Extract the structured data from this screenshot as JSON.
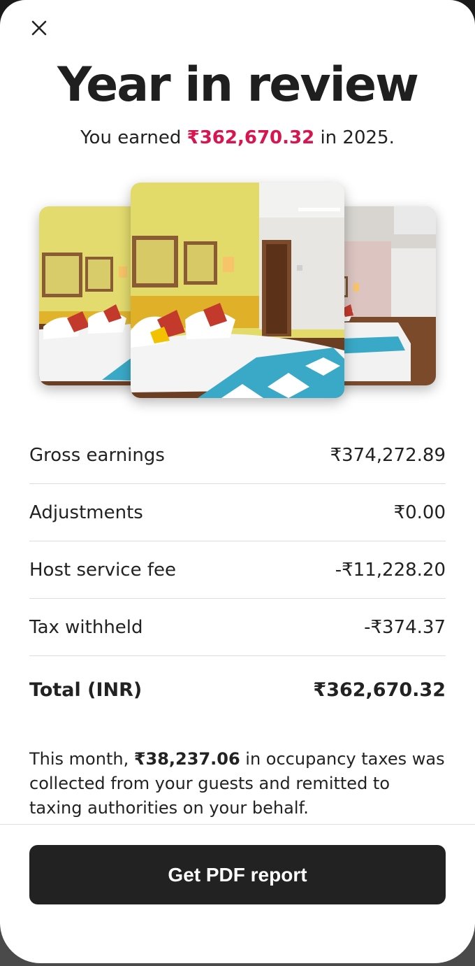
{
  "header": {
    "close_icon": "close-icon",
    "title": "Year in review",
    "subtitle_prefix": "You earned ",
    "subtitle_amount": "₹362,670.32",
    "subtitle_suffix": " in 2025.",
    "accent_color": "#d7164f"
  },
  "photos": [
    {
      "name": "listing-photo-left"
    },
    {
      "name": "listing-photo-center"
    },
    {
      "name": "listing-photo-right"
    }
  ],
  "summary": {
    "rows": [
      {
        "label": "Gross earnings",
        "value": "₹374,272.89"
      },
      {
        "label": "Adjustments",
        "value": "₹0.00"
      },
      {
        "label": "Host service fee",
        "value": "-₹11,228.20"
      },
      {
        "label": "Tax withheld",
        "value": "-₹374.37"
      }
    ],
    "total": {
      "label": "Total (INR)",
      "value": "₹362,670.32"
    }
  },
  "note": {
    "prefix": "This month, ",
    "amount": "₹38,237.06",
    "suffix": " in occupancy taxes was collected from your guests and remitted to taxing authorities on your behalf."
  },
  "footer": {
    "button_label": "Get PDF report",
    "button_color": "#222222"
  }
}
